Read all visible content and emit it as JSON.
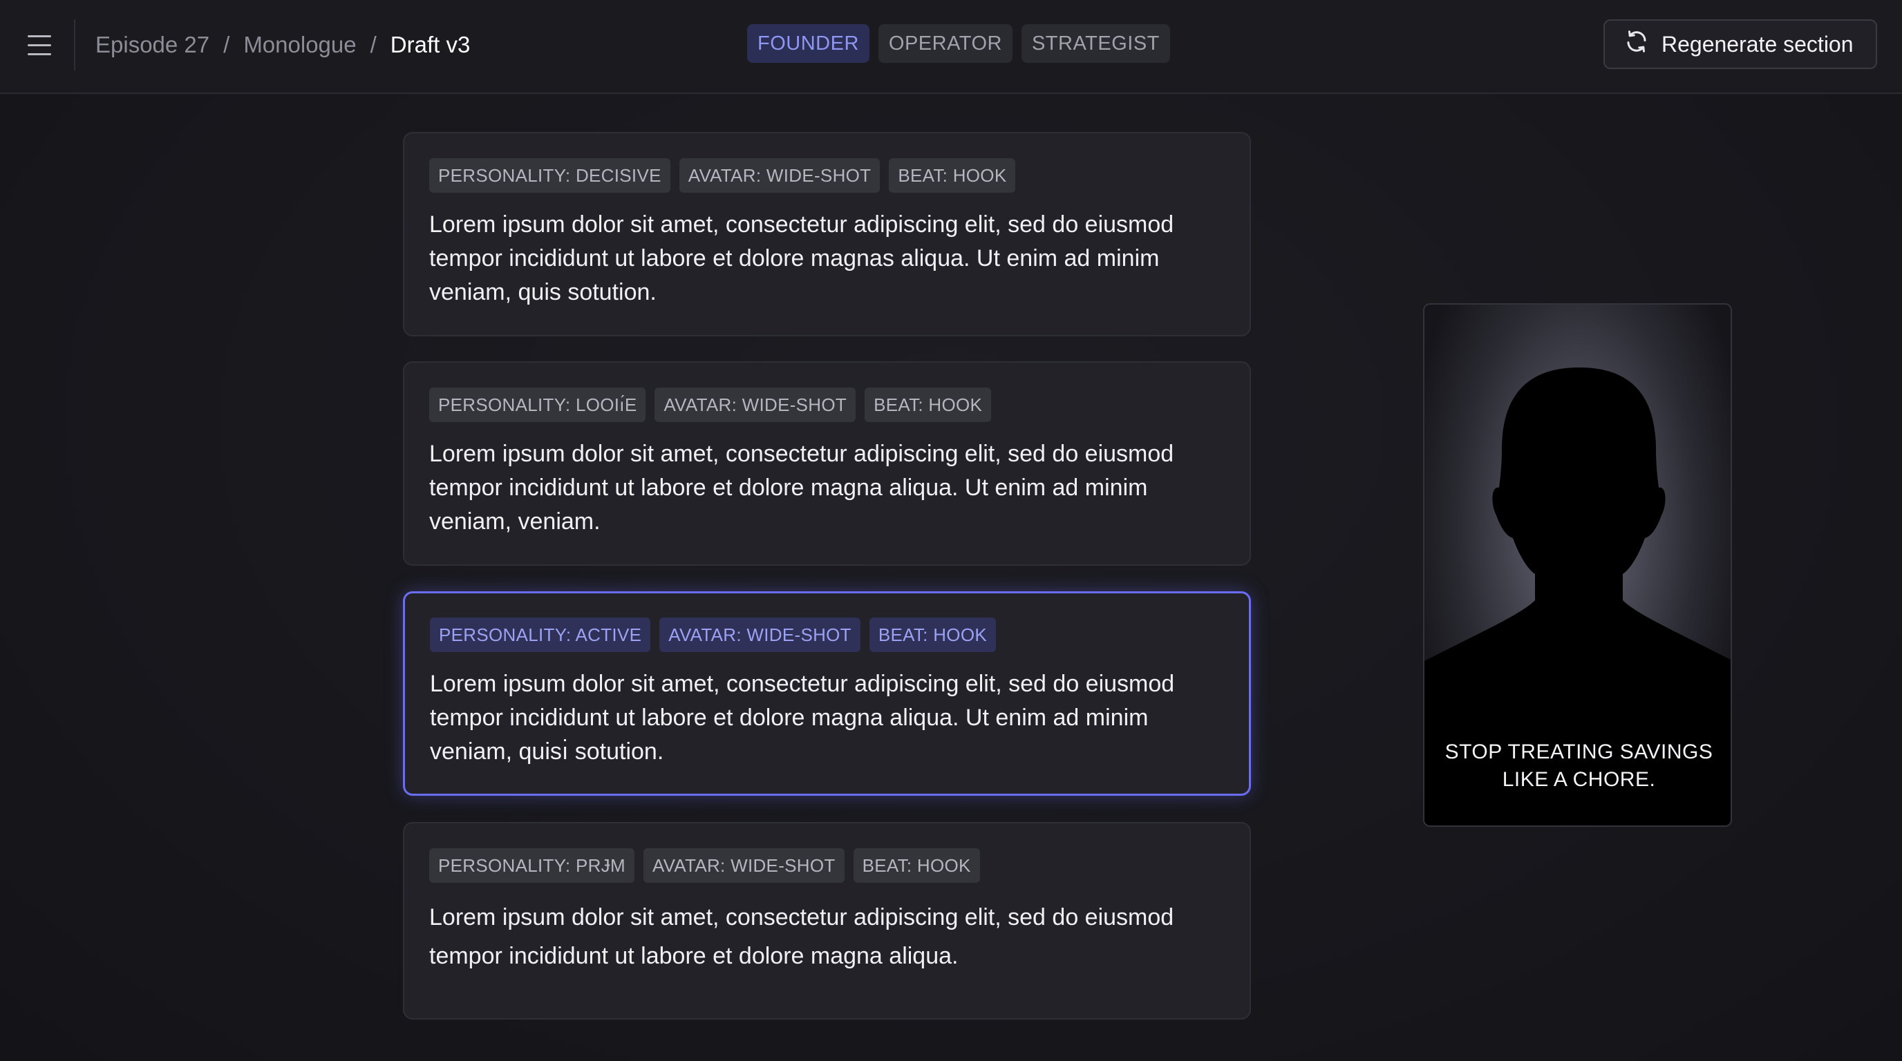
{
  "breadcrumb": {
    "items": [
      "Episode 27",
      "Monologue",
      "Draft v3"
    ],
    "separator": "/"
  },
  "persona_tabs": [
    {
      "label": "FOUNDER",
      "active": true
    },
    {
      "label": "OPERATOR",
      "active": false
    },
    {
      "label": "STRATEGIST",
      "active": false
    }
  ],
  "regenerate": {
    "label": "Regenerate section",
    "icon": "refresh-icon"
  },
  "cards": [
    {
      "tags": [
        "PERSONALITY: DECISIVE",
        "AVATAR: WIDE-SHOT",
        "BEAT: HOOK"
      ],
      "text": "Lorem ipsum dolor sit amet, consectetur adipiscing elit, sed do eiusmod tempor incididunt ut labore et dolore magnas aliqua. Ut enim ad minim veniam, quis sotution.",
      "selected": false
    },
    {
      "tags": [
        "PERSONALITY: LOOIı́E",
        "AVATAR: WIDE-SHOT",
        "BEAT: HOOK"
      ],
      "text": "Lorem ipsum dolor sit amet, consectetur adipiscing elit, sed do eiusmod tempor incididunt ut labore et dolore magna aliqua. Ut enim ad minim veniam, veniam.",
      "selected": false
    },
    {
      "tags": [
        "PERSONALITY: ACTIVE",
        "AVATAR: WIDE-SHOT",
        "BEAT: HOOK"
      ],
      "text": "Lorem ipsum dolor sit amet, consectetur adipiscing elit, sed do eiusmod tempor incididunt ut labore et dolore magna aliqua. Ut enim ad minim veniam, quisı̇ sotution.",
      "selected": true
    },
    {
      "tags": [
        "PERSONALITY: PRɈM",
        "AVATAR: WIDE-SHOT",
        "BEAT: HOOK"
      ],
      "text": "Lorem ipsum dolor sit amet, consectetur adipiscing elit, sed do eiusmod tempor incididunt ut labore et dolore magna aliqua.",
      "selected": false
    }
  ],
  "preview": {
    "caption_line1": "STOP TREATING SAVINGS",
    "caption_line2": "LIKE A CHORE."
  },
  "colors": {
    "accent": "#6b6ef5",
    "accent_text": "#8f97f2",
    "background": "#18181d",
    "card": "#222228"
  }
}
